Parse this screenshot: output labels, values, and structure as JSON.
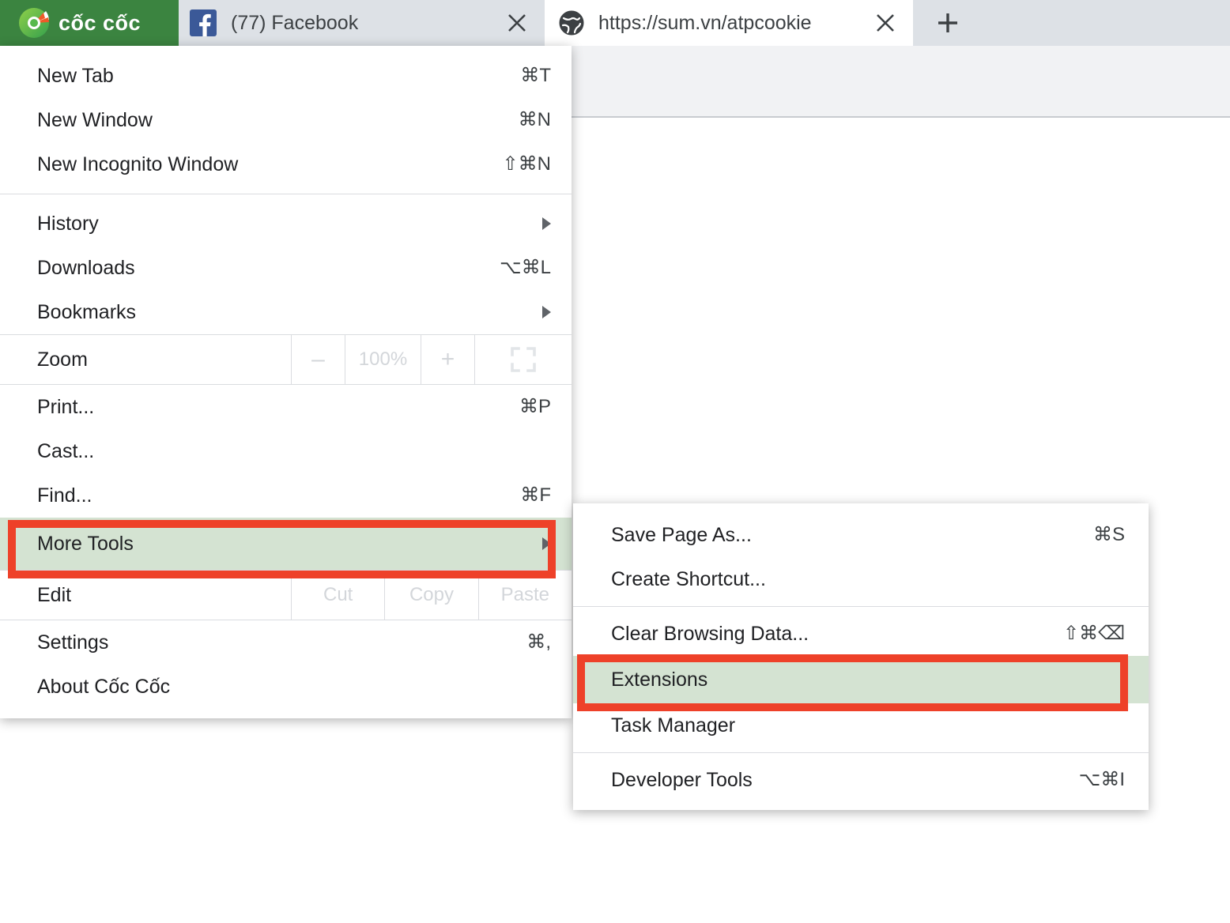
{
  "browser": {
    "brand_name": "cốc cốc",
    "brand_color": "#3b8440",
    "newtab_icon": "plus-icon"
  },
  "tabs": [
    {
      "title": "(77) Facebook",
      "favicon": "facebook-icon",
      "close_icon": "close-icon",
      "active": false
    },
    {
      "title": "https://sum.vn/atpcookie",
      "favicon": "globe-icon",
      "close_icon": "close-icon",
      "active": true
    }
  ],
  "main_menu": {
    "items": [
      {
        "label": "New Tab",
        "accel": "⌘T",
        "arrow": false
      },
      {
        "label": "New Window",
        "accel": "⌘N",
        "arrow": false
      },
      {
        "label": "New Incognito Window",
        "accel": "⇧⌘N",
        "arrow": false
      },
      {
        "label": "History",
        "accel": "",
        "arrow": true
      },
      {
        "label": "Downloads",
        "accel": "⌥⌘L",
        "arrow": false
      },
      {
        "label": "Bookmarks",
        "accel": "",
        "arrow": true
      }
    ],
    "zoom_row": {
      "label": "Zoom",
      "minus": "–",
      "level": "100%",
      "plus": "+",
      "fullscreen_icon": "fullscreen-icon"
    },
    "items_mid": [
      {
        "label": "Print...",
        "accel": "⌘P",
        "arrow": false
      },
      {
        "label": "Cast...",
        "accel": "",
        "arrow": false
      },
      {
        "label": "Find...",
        "accel": "⌘F",
        "arrow": false
      }
    ],
    "more_tools": {
      "label": "More Tools",
      "accel": "",
      "arrow": true,
      "highlighted": true,
      "highlight_fill": "#d4e3d2",
      "highlight_border": "#ee4129"
    },
    "edit_row": {
      "label": "Edit",
      "cut": "Cut",
      "copy": "Copy",
      "paste": "Paste"
    },
    "items_end": [
      {
        "label": "Settings",
        "accel": "⌘,",
        "arrow": false
      },
      {
        "label": "About Cốc Cốc",
        "accel": "",
        "arrow": false
      }
    ]
  },
  "submenu": {
    "items": [
      {
        "label": "Save Page As...",
        "accel": "⌘S",
        "highlighted": false
      },
      {
        "label": "Create Shortcut...",
        "accel": "",
        "highlighted": false
      },
      {
        "label": "Clear Browsing Data...",
        "accel": "⇧⌘⌫",
        "highlighted": false
      },
      {
        "label": "Extensions",
        "accel": "",
        "highlighted": true
      },
      {
        "label": "Task Manager",
        "accel": "",
        "highlighted": false
      },
      {
        "label": "Developer Tools",
        "accel": "⌥⌘I",
        "highlighted": false
      }
    ],
    "highlight_fill": "#d4e3d2",
    "highlight_border": "#ee4129"
  }
}
